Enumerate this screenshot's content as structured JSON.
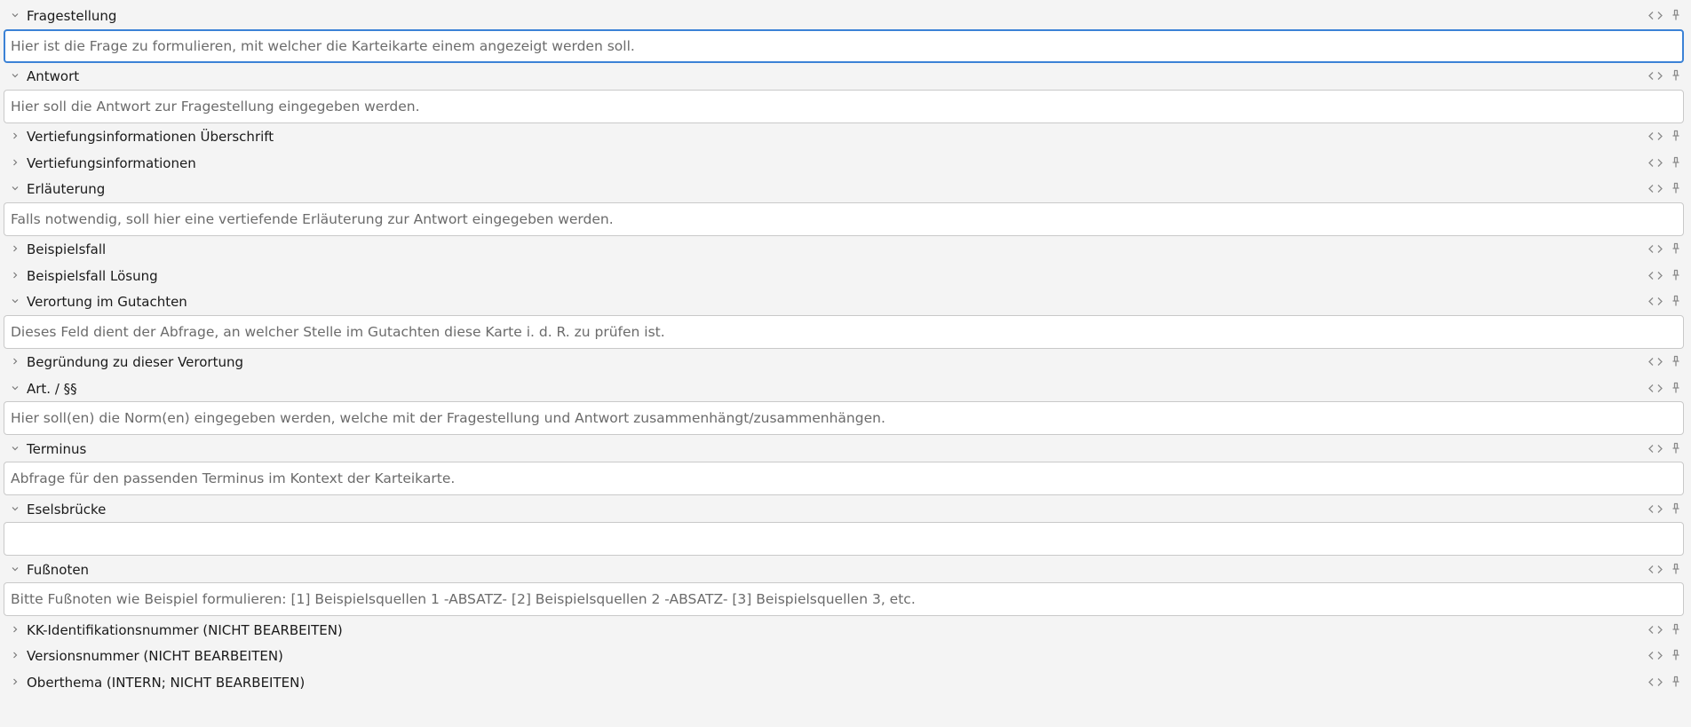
{
  "fields": [
    {
      "id": "fragestellung",
      "label": "Fragestellung",
      "expanded": true,
      "focused": true,
      "placeholder": "Hier ist die Frage zu formulieren, mit welcher die Karteikarte einem angezeigt werden soll."
    },
    {
      "id": "antwort",
      "label": "Antwort",
      "expanded": true,
      "focused": false,
      "placeholder": "Hier soll die Antwort zur Fragestellung eingegeben werden."
    },
    {
      "id": "vertiefungsinfo-ueberschrift",
      "label": "Vertiefungsinformationen Überschrift",
      "expanded": false,
      "focused": false,
      "placeholder": ""
    },
    {
      "id": "vertiefungsinfo",
      "label": "Vertiefungsinformationen",
      "expanded": false,
      "focused": false,
      "placeholder": ""
    },
    {
      "id": "erlaeuterung",
      "label": "Erläuterung",
      "expanded": true,
      "focused": false,
      "placeholder": "Falls notwendig, soll hier eine vertiefende Erläuterung zur Antwort eingegeben werden."
    },
    {
      "id": "beispielsfall",
      "label": "Beispielsfall",
      "expanded": false,
      "focused": false,
      "placeholder": ""
    },
    {
      "id": "beispielsfall-loesung",
      "label": "Beispielsfall Lösung",
      "expanded": false,
      "focused": false,
      "placeholder": ""
    },
    {
      "id": "verortung",
      "label": "Verortung im Gutachten",
      "expanded": true,
      "focused": false,
      "placeholder": "Dieses Feld dient der Abfrage, an welcher Stelle im Gutachten diese Karte i. d. R. zu prüfen ist."
    },
    {
      "id": "begruendung-verortung",
      "label": "Begründung zu dieser Verortung",
      "expanded": false,
      "focused": false,
      "placeholder": ""
    },
    {
      "id": "art-paragraphen",
      "label": "Art. / §§",
      "expanded": true,
      "focused": false,
      "placeholder": "Hier soll(en) die Norm(en) eingegeben werden, welche mit der Fragestellung und Antwort zusammenhängt/zusammenhängen."
    },
    {
      "id": "terminus",
      "label": "Terminus",
      "expanded": true,
      "focused": false,
      "placeholder": "Abfrage für den passenden Terminus im Kontext der Karteikarte."
    },
    {
      "id": "eselsbruecke",
      "label": "Eselsbrücke",
      "expanded": true,
      "focused": false,
      "placeholder": ""
    },
    {
      "id": "fussnoten",
      "label": "Fußnoten",
      "expanded": true,
      "focused": false,
      "placeholder": "Bitte Fußnoten wie Beispiel formulieren: [1] Beispielsquellen 1 -ABSATZ- [2] Beispielsquellen 2 -ABSATZ- [3] Beispielsquellen 3, etc."
    },
    {
      "id": "kk-id",
      "label": "KK-Identifikationsnummer (NICHT BEARBEITEN)",
      "expanded": false,
      "focused": false,
      "placeholder": ""
    },
    {
      "id": "versionsnummer",
      "label": "Versionsnummer (NICHT BEARBEITEN)",
      "expanded": false,
      "focused": false,
      "placeholder": ""
    },
    {
      "id": "oberthema",
      "label": "Oberthema (INTERN; NICHT BEARBEITEN)",
      "expanded": false,
      "focused": false,
      "placeholder": ""
    }
  ],
  "icons": {
    "expanded": "chevron-down-icon",
    "collapsed": "chevron-right-icon",
    "html_toggle": "code-brackets-icon",
    "sticky": "pin-icon"
  },
  "colors": {
    "background": "#f4f4f4",
    "input_background": "#ffffff",
    "input_border": "#c9c9c9",
    "focus_border": "#3b82d6",
    "placeholder_text": "#6b6b6b",
    "icon": "#8a8a8a"
  }
}
